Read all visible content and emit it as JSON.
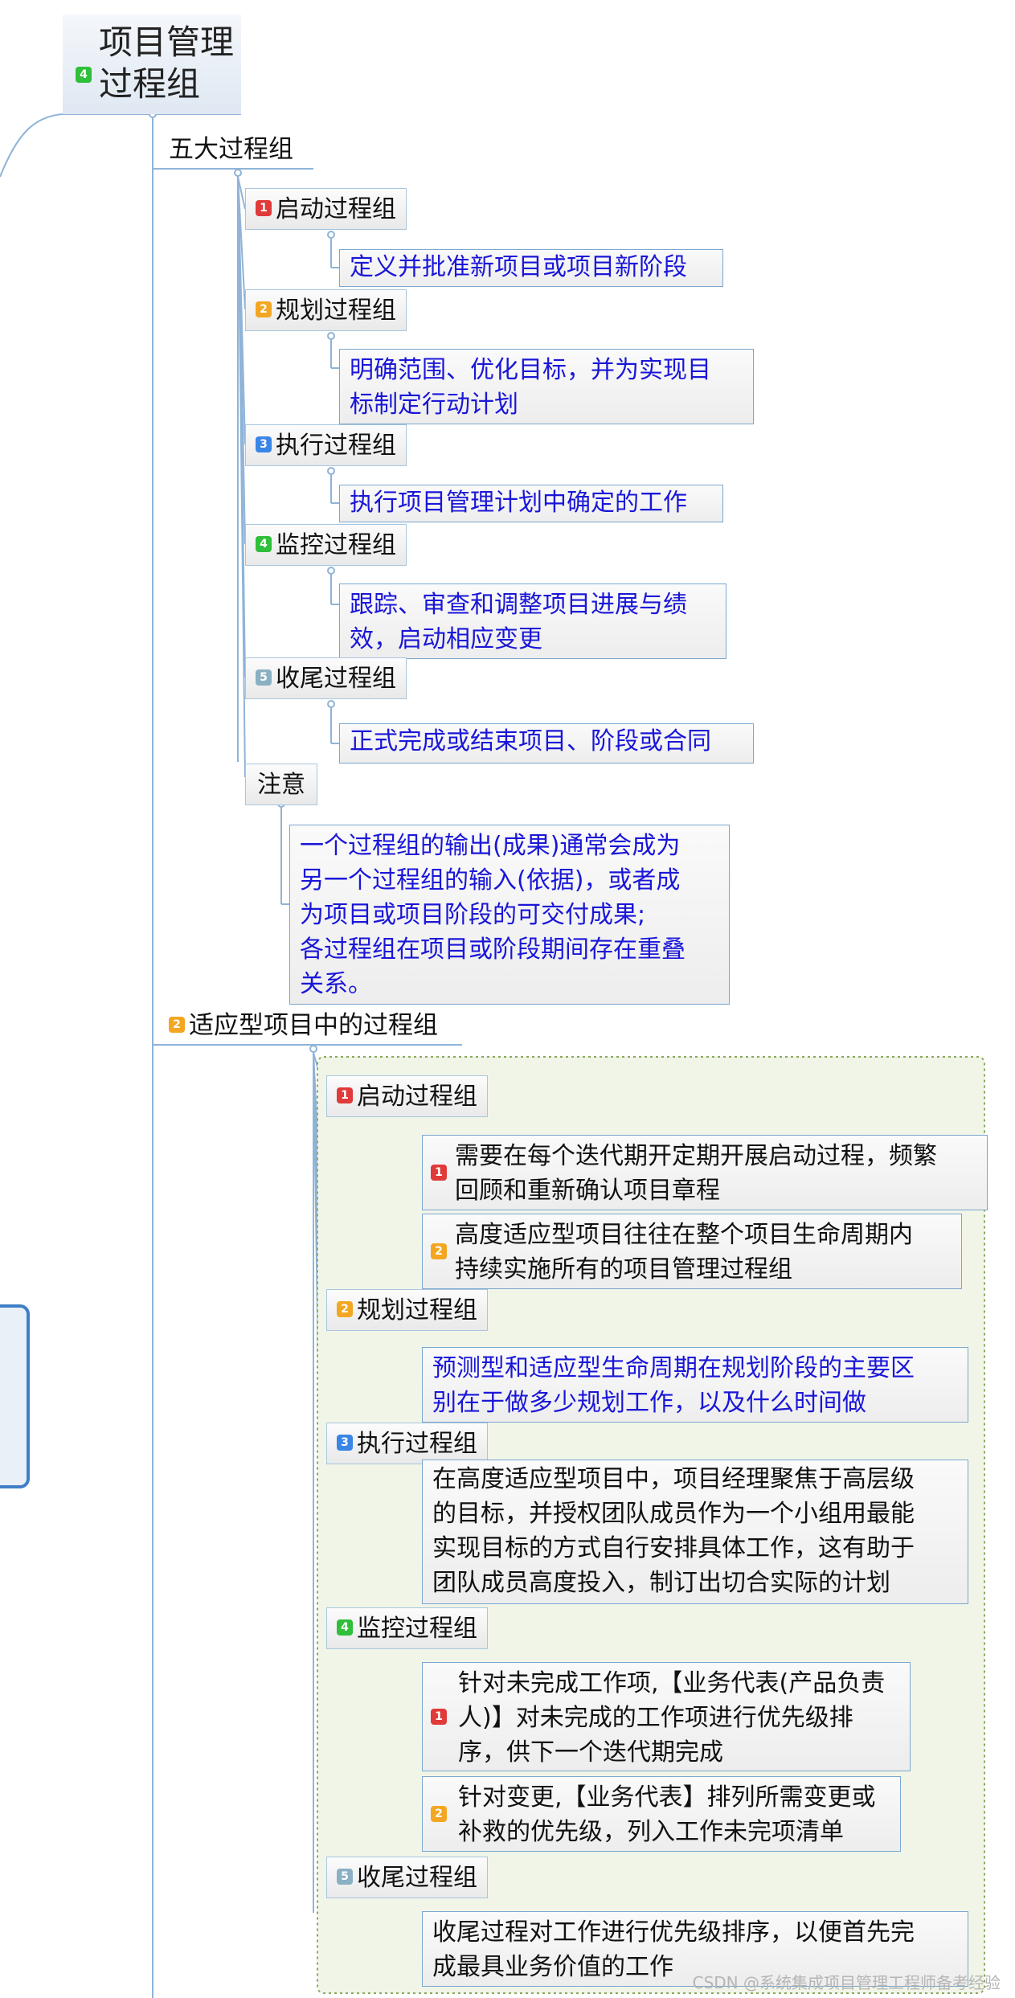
{
  "root": {
    "badge": "4",
    "line1": "项目管理",
    "line2": "过程组"
  },
  "five_groups": {
    "title": "五大过程组",
    "items": [
      {
        "badge": "1",
        "label": "启动过程组",
        "desc": "定义并批准新项目或项目新阶段"
      },
      {
        "badge": "2",
        "label": "规划过程组",
        "desc_l1": "明确范围、优化目标，并为实现目",
        "desc_l2": "标制定行动计划"
      },
      {
        "badge": "3",
        "label": "执行过程组",
        "desc": "执行项目管理计划中确定的工作"
      },
      {
        "badge": "4",
        "label": "监控过程组",
        "desc_l1": "跟踪、审查和调整项目进展与绩",
        "desc_l2": "效，启动相应变更"
      },
      {
        "badge": "5",
        "label": "收尾过程组",
        "desc": "正式完成或结束项目、阶段或合同"
      }
    ],
    "note": {
      "label": "注意",
      "l1": "一个过程组的输出(成果)通常会成为",
      "l2": "另一个过程组的输入(依据)，或者成",
      "l3": "为项目或项目阶段的可交付成果;",
      "l4": "各过程组在项目或阶段期间存在重叠",
      "l5": "关系。"
    }
  },
  "adaptive": {
    "badge": "2",
    "title": "适应型项目中的过程组",
    "initiating": {
      "badge": "1",
      "label": "启动过程组",
      "n1": {
        "badge": "1",
        "l1": "需要在每个迭代期开定期开展启动过程，频繁",
        "l2": "回顾和重新确认项目章程"
      },
      "n2": {
        "badge": "2",
        "l1": "高度适应型项目往往在整个项目生命周期内",
        "l2": "持续实施所有的项目管理过程组"
      }
    },
    "planning": {
      "badge": "2",
      "label": "规划过程组",
      "n1": {
        "l1": "预测型和适应型生命周期在规划阶段的主要区",
        "l2": "别在于做多少规划工作，以及什么时间做"
      }
    },
    "executing": {
      "badge": "3",
      "label": "执行过程组",
      "n1": {
        "l1": "在高度适应型项目中，项目经理聚焦于高层级",
        "l2": "的目标，并授权团队成员作为一个小组用最能",
        "l3": "实现目标的方式自行安排具体工作，这有助于",
        "l4": "团队成员高度投入，制订出切合实际的计划"
      }
    },
    "monitoring": {
      "badge": "4",
      "label": "监控过程组",
      "n1": {
        "badge": "1",
        "l1": "针对未完成工作项,【业务代表(产品负责",
        "l2": "人)】对未完成的工作项进行优先级排",
        "l3": "序，供下一个迭代期完成"
      },
      "n2": {
        "badge": "2",
        "l1": "针对变更,【业务代表】排列所需变更或",
        "l2": "补救的优先级，列入工作未完项清单"
      }
    },
    "closing": {
      "badge": "5",
      "label": "收尾过程组",
      "n1": {
        "l1": "收尾过程对工作进行优先级排序，以便首先完",
        "l2": "成最具业务价值的工作"
      }
    }
  },
  "watermark": "CSDN @系统集成项目管理工程师备考经验"
}
